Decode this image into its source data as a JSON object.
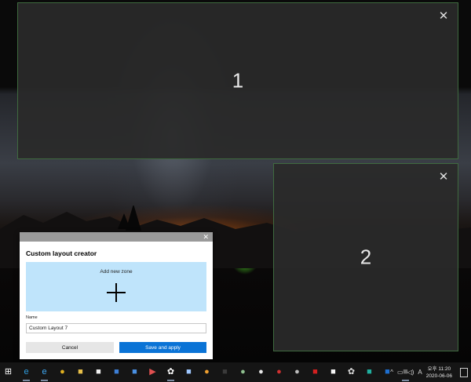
{
  "zones": [
    {
      "number": "1",
      "close_glyph": "✕"
    },
    {
      "number": "2",
      "close_glyph": "✕"
    }
  ],
  "editor": {
    "close_glyph": "✕",
    "title": "Custom layout creator",
    "add_zone_label": "Add new zone",
    "name_label": "Name",
    "name_value": "Custom Layout 7",
    "cancel_label": "Cancel",
    "save_label": "Save and apply"
  },
  "taskbar": {
    "start_glyph": "⊞",
    "apps": [
      {
        "name": "edge",
        "glyph": "e",
        "color": "#2f9de0"
      },
      {
        "name": "internet-explorer",
        "glyph": "e",
        "color": "#3fa9f5"
      },
      {
        "name": "chrome",
        "glyph": "●",
        "color": "#e0b020"
      },
      {
        "name": "file-explorer",
        "glyph": "■",
        "color": "#e8c04a"
      },
      {
        "name": "store",
        "glyph": "■",
        "color": "#f0f0f0"
      },
      {
        "name": "mail",
        "glyph": "■",
        "color": "#3d7fd6"
      },
      {
        "name": "photos",
        "glyph": "■",
        "color": "#4a90e2"
      },
      {
        "name": "media-player",
        "glyph": "▶",
        "color": "#e05050"
      },
      {
        "name": "settings",
        "glyph": "✿",
        "color": "#ffffff"
      },
      {
        "name": "notepad",
        "glyph": "■",
        "color": "#9fc8ff"
      },
      {
        "name": "paint",
        "glyph": "●",
        "color": "#f0a030"
      },
      {
        "name": "terminal",
        "glyph": "■",
        "color": "#3a3a3a"
      },
      {
        "name": "camera",
        "glyph": "●",
        "color": "#8fbf8f"
      },
      {
        "name": "game",
        "glyph": "●",
        "color": "#e8e8e8"
      },
      {
        "name": "recorder",
        "glyph": "●",
        "color": "#d03030"
      },
      {
        "name": "cloud",
        "glyph": "●",
        "color": "#bcbcbc"
      },
      {
        "name": "reader",
        "glyph": "■",
        "color": "#d32020"
      },
      {
        "name": "office",
        "glyph": "■",
        "color": "#f5f5f5"
      },
      {
        "name": "network-tool",
        "glyph": "✿",
        "color": "#dddddd"
      },
      {
        "name": "teal-app",
        "glyph": "■",
        "color": "#20b0a0"
      },
      {
        "name": "blue-app",
        "glyph": "■",
        "color": "#1e6fd0"
      },
      {
        "name": "powertoys",
        "glyph": "■",
        "color": "#6a6a6a"
      }
    ],
    "tray": {
      "chevron": "^",
      "net": "▭",
      "volume": "◁)",
      "ime": "A",
      "time": "오후 11:20",
      "date": "2020-06-06"
    }
  }
}
